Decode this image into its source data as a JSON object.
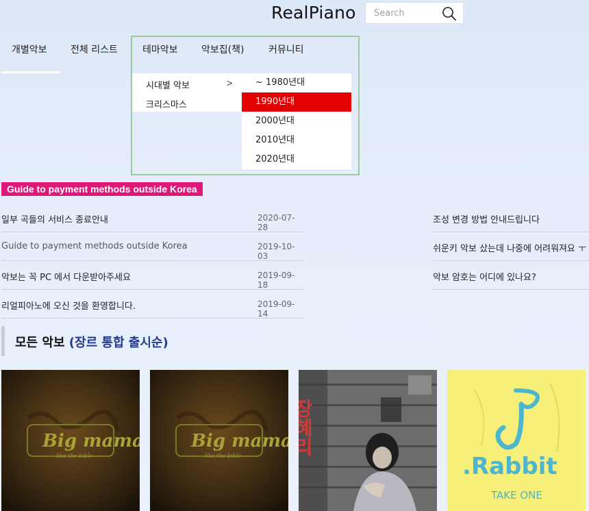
{
  "header": {
    "logo": "RealPiano",
    "search_placeholder": "Search"
  },
  "nav": {
    "items": [
      "개별악보",
      "전체 리스트",
      "테마악보",
      "악보집(책)",
      "커뮤니티"
    ],
    "active_index": 0
  },
  "dropdown": {
    "categories": [
      {
        "label": "시대별 악보",
        "has_submenu": true
      },
      {
        "label": "크리스마스",
        "has_submenu": false
      }
    ],
    "arrow": ">",
    "eras": [
      "~ 1980년대",
      "1990년대",
      "2000년대",
      "2010년대",
      "2020년대"
    ],
    "selected_era": "1990년대",
    "colors": {
      "selected_bg": "#e20000",
      "border": "#9cc9a0"
    }
  },
  "guide_banner": {
    "text": "Guide to payment methods outside Korea",
    "color": "#e0177a"
  },
  "notices_left": [
    {
      "title": "일부 곡들의 서비스 종료안내",
      "date": "2020-07-28"
    },
    {
      "title": "Guide to payment methods outside Korea",
      "date": "2019-10-03"
    },
    {
      "title": "악보는 꼭 PC 에서 다운받아주세요",
      "date": "2019-09-18"
    },
    {
      "title": "리얼피아노에 오신 것을 환영합니다.",
      "date": "2019-09-14"
    }
  ],
  "notices_right": [
    {
      "title": "조성 변경 방법 안내드립니다"
    },
    {
      "title": "쉬운키 악보 샀는데 나중에 어려워져요 ㅜ"
    },
    {
      "title": "악보 암호는 어디에 있나요?"
    }
  ],
  "section": {
    "title": "모든 악보",
    "subtitle": "(장르 통합 출시순)",
    "accent_color": "#233a8f"
  },
  "albums": [
    {
      "cover_text": "Big mama",
      "cover_sub": "like the bible",
      "style": "bigmama"
    },
    {
      "cover_text": "Big mama",
      "cover_sub": "like the bible",
      "style": "bigmama"
    },
    {
      "cover_text": "장혜리",
      "style": "photo"
    },
    {
      "cover_text": ".Rabbit",
      "cover_sub": "TAKE ONE",
      "style": "rabbit"
    }
  ]
}
